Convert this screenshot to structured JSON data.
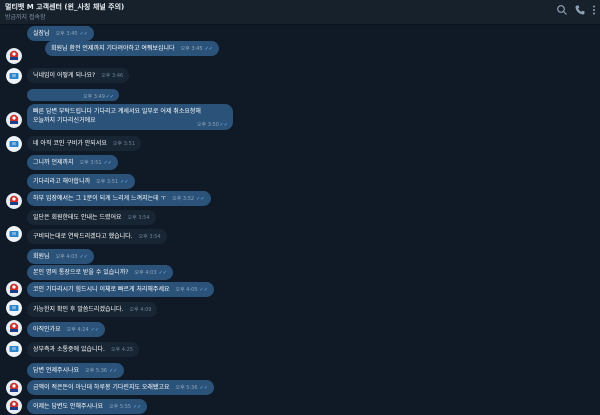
{
  "header": {
    "title": "멀티뱃 M 고객센터 (윈_사칭 채널 주의)",
    "status": "방금까지 접속함"
  },
  "colors": {
    "incoming": "#182533",
    "outgoing": "#2b5278",
    "check": "#6fb6ff"
  },
  "messages": [
    {
      "text": "실장님",
      "time": "오후 3:45",
      "dir": "out"
    },
    {
      "text": "회원님 환전 언제까지 기다려야하고 여쭤보십니다",
      "time": "오후 3:45",
      "dir": "out"
    },
    {
      "text": "닉네임이 어떻게 되나요?",
      "time": "오후 3:46",
      "dir": "in"
    },
    {
      "text": "",
      "time": "오후 3:49",
      "dir": "out"
    },
    {
      "text": "빠른 답변 부탁드립니다 기다리고 계세서요 일부로 어제 취소요청해 오늘까지 기다리신거에요",
      "line1": "빠른 답변 부탁드립니다 기다리고 계세서요 일부로 어제 취소요청해",
      "line2": "오늘까지 기다리신거에요",
      "time": "오후 3:50",
      "dir": "out"
    },
    {
      "text": "네 아직 코인 구비가 안되서요",
      "time": "오후 3:51",
      "dir": "in"
    },
    {
      "text": "그니까 언제까지",
      "time": "오후 3:51",
      "dir": "out"
    },
    {
      "text": "기다리라고 해야합니까",
      "time": "오후 3:51",
      "dir": "out"
    },
    {
      "text": "하부 입장에서는 그 1분이 되게 느리게 느껴지는데 ㅜ",
      "time": "오후 3:52",
      "dir": "out"
    },
    {
      "text": "일단은 회원한테도 안내는 드렸어요",
      "time": "오후 3:54",
      "dir": "in"
    },
    {
      "text": "구비되는대로 연락드리겠다고 했습니다.",
      "time": "오후 3:54",
      "dir": "in"
    },
    {
      "text": "회원님",
      "time": "오후 4:03",
      "dir": "out"
    },
    {
      "text": "본인 명의 통장으로 받을 수 있습니까?",
      "time": "오후 4:03",
      "dir": "out"
    },
    {
      "text": "코인 기다리시기 힘드시니 이체로 빠르게 처리해주세요",
      "time": "오후 4:05",
      "dir": "out"
    },
    {
      "text": "가능한지 확인 후 말씀드리겠습니다.",
      "time": "오후 4:09",
      "dir": "in"
    },
    {
      "text": "아직인가요",
      "time": "오후 4:24",
      "dir": "out"
    },
    {
      "text": "상부측과 소통중에 있습니다.",
      "time": "오후 4:25",
      "dir": "in"
    },
    {
      "text": "답변 언제주시나요",
      "time": "오후 5:36",
      "dir": "out"
    },
    {
      "text": "금액이 적은돈이 아닌데 하루봉 기다린지도 오래됐고요",
      "time": "오후 5:36",
      "dir": "out"
    },
    {
      "text": "이제는 답변도 안해주시나요",
      "time": "오후 5:55",
      "dir": "out"
    }
  ]
}
